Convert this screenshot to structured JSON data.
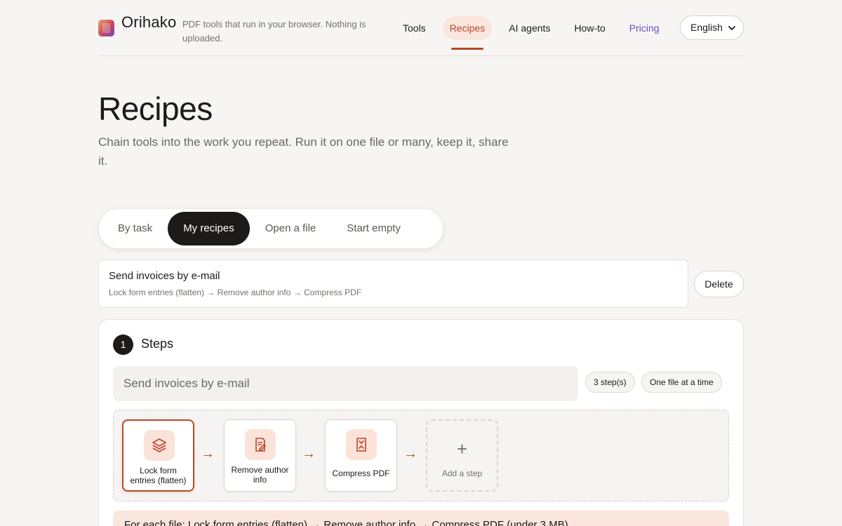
{
  "header": {
    "brand": "Orihako",
    "tagline": "PDF tools that run in your browser. Nothing is uploaded.",
    "nav": [
      {
        "label": "Tools"
      },
      {
        "label": "Recipes",
        "active": true
      },
      {
        "label": "AI agents"
      },
      {
        "label": "How-to"
      },
      {
        "label": "Pricing"
      }
    ],
    "language": "English",
    "icons": {
      "logo": "orihako-logo",
      "language_chevron": "chevron-down-icon"
    }
  },
  "hero": {
    "title": "Recipes",
    "subtitle": "Chain tools into the work you repeat. Run it on one file or many, keep it, share it."
  },
  "tabs": [
    {
      "label": "By task"
    },
    {
      "label": "My recipes",
      "active": true
    },
    {
      "label": "Open a file"
    },
    {
      "label": "Start empty"
    }
  ],
  "recipe": {
    "name": "Send invoices by e-mail",
    "chain": "Lock form entries (flatten) → Remove author info → Compress PDF",
    "delete_label": "Delete"
  },
  "steps_panel": {
    "number": "1",
    "title": "Steps",
    "name_value": "Send invoices by e-mail",
    "step_count": "3 step(s)",
    "mode": "One file at a time",
    "steps": [
      {
        "label": "Lock form entries (flatten)",
        "icon": "layers-icon"
      },
      {
        "label": "Remove author info",
        "icon": "document-edit-icon"
      },
      {
        "label": "Compress PDF",
        "icon": "compress-icon"
      }
    ],
    "add_step_label": "Add a step",
    "add_step_symbol": "+",
    "arrow_symbol": "→",
    "summary": "For each file: Lock form entries (flatten) → Remove author info → Compress PDF (under 3 MB)"
  },
  "colors": {
    "accent": "#b9472a",
    "accent_soft": "#fbe6de",
    "pricing": "#6b4bc7",
    "background": "#f7f5f3",
    "dark": "#1d1a18"
  }
}
